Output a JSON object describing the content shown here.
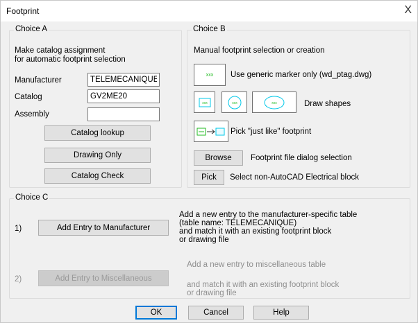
{
  "window": {
    "title": "Footprint",
    "close_glyph": "X"
  },
  "choice_a": {
    "legend": "Choice A",
    "desc_line1": "Make catalog assignment",
    "desc_line2": "for automatic footprint selection",
    "manufacturer_label": "Manufacturer",
    "manufacturer_value": "TELEMECANIQUE",
    "catalog_label": "Catalog",
    "catalog_value": "GV2ME20",
    "assembly_label": "Assembly",
    "assembly_value": "",
    "catalog_lookup_label": "Catalog lookup",
    "drawing_only_label": "Drawing Only",
    "catalog_check_label": "Catalog Check"
  },
  "choice_b": {
    "legend": "Choice B",
    "desc": "Manual footprint selection or creation",
    "generic_marker_icon_text": "xxx",
    "generic_marker_label": "Use generic marker only (wd_ptag.dwg)",
    "shape_icon_text": "xxx",
    "draw_shapes_label": "Draw shapes",
    "just_like_label": "Pick \"just like\" footprint",
    "browse_label": "Browse",
    "browse_desc": "Footprint file dialog selection",
    "pick_label": "Pick",
    "pick_desc": "Select non-AutoCAD Electrical block"
  },
  "choice_c": {
    "legend": "Choice C",
    "item1_num": "1)",
    "add_manufacturer_label": "Add Entry to Manufacturer",
    "item1_desc1": "Add a new entry to the manufacturer-specific table",
    "item1_desc2": "(table name: TELEMECANIQUE)",
    "item1_desc3": "and match it with an existing footprint block",
    "item1_desc4": "or drawing file",
    "item2_num": "2)",
    "add_misc_label": "Add Entry to Miscellaneous",
    "item2_desc1": "Add a new entry to miscellaneous table",
    "item2_desc2": "and match it with an existing footprint block",
    "item2_desc3": "or drawing file"
  },
  "footer": {
    "ok_label": "OK",
    "cancel_label": "Cancel",
    "help_label": "Help"
  },
  "colors": {
    "icon_accent": "#22bb22",
    "icon_outline": "#00c8e8",
    "default_focus": "#0078d7"
  }
}
